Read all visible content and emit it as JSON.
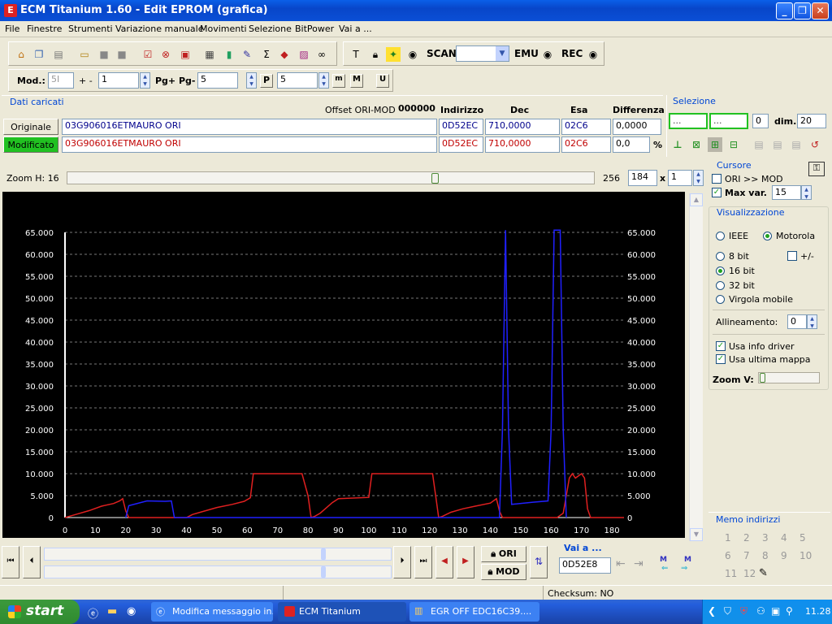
{
  "window": {
    "title": "ECM Titanium 1.60 - Edit EPROM (grafica)",
    "icon": "E",
    "min": "_",
    "max": "❐",
    "close": "✕"
  },
  "menu": [
    "File",
    "Finestre",
    "Strumenti",
    "Variazione manuale",
    "Movimenti",
    "Selezione",
    "BitPower",
    "Vai a ..."
  ],
  "toolbar1": {
    "scan_label": "SCAN",
    "emu_label": "EMU",
    "rec_label": "REC"
  },
  "toolbar2": {
    "mod_label": "Mod.:",
    "mod_value": "5I",
    "plusminus_label": "+ -",
    "plusminus_value": "1",
    "pg_label": "Pg+ Pg-",
    "pg_value": "5",
    "p_value": "5",
    "p_icon": "P",
    "m_icon": "m",
    "M_icon": "M",
    "U_icon": "U"
  },
  "dati": {
    "title": "Dati caricati",
    "offset_label": "Offset ORI-MOD",
    "offset_value": "000000",
    "col_indirizzo": "Indirizzo",
    "col_dec": "Dec",
    "col_esa": "Esa",
    "col_diff": "Differenza",
    "ori_button": "Originale",
    "mod_button": "Modificato",
    "ori": {
      "name": "03G906016ETMAURO ORI",
      "addr": "0D52EC",
      "dec": "710,0000",
      "esa": "02C6",
      "diff": "0,0000"
    },
    "mod": {
      "name": "03G906016ETMAURO ORI",
      "addr": "0D52EC",
      "dec": "710,0000",
      "esa": "02C6",
      "diff": "0,0",
      "pct": "%"
    }
  },
  "selezione": {
    "title": "Selezione",
    "from": "...",
    "to": "...",
    "count": "0",
    "dim_label": "dim.",
    "dim_value": "20"
  },
  "zoom": {
    "label": "Zoom H: 16",
    "right_value": "256",
    "val1": "184",
    "times": "x",
    "val2": "1"
  },
  "cursore": {
    "title": "Cursore",
    "ori_mod_label": "ORI >> MOD",
    "maxvar_label": "Max var.",
    "maxvar_value": "15"
  },
  "visualizzazione": {
    "title": "Visualizzazione",
    "ieee": "IEEE",
    "motorola": "Motorola",
    "bit8": "8 bit",
    "plusminus": "+/-",
    "bit16": "16 bit",
    "bit32": "32 bit",
    "float": "Virgola mobile",
    "allineamento_label": "Allineamento:",
    "allineamento_value": "0",
    "usa_info": "Usa info driver",
    "usa_ultima": "Usa ultima mappa",
    "zoomv_label": "Zoom V:"
  },
  "memo": {
    "title": "Memo indirizzi",
    "numbers": [
      "1",
      "2",
      "3",
      "4",
      "5",
      "6",
      "7",
      "8",
      "9",
      "10",
      "11",
      "12"
    ]
  },
  "nav": {
    "ori_label": "ORI",
    "mod_label": "MOD",
    "vai_label": "Vai a ...",
    "vai_value": "0D52E8",
    "m_left": "M",
    "m_right": "M"
  },
  "status": {
    "checksum": "Checksum: NO"
  },
  "taskbar": {
    "start": "start",
    "tasks": [
      "Modifica messaggio in...",
      "ECM Titanium",
      "EGR OFF EDC16C39...."
    ],
    "clock": "11.28"
  },
  "chart_data": {
    "type": "line",
    "xlabel": "",
    "ylabel": "",
    "xlim": [
      0,
      184
    ],
    "ylim": [
      0,
      65000
    ],
    "x_ticks": [
      0,
      10,
      20,
      30,
      40,
      50,
      60,
      70,
      80,
      90,
      100,
      110,
      120,
      130,
      140,
      150,
      160,
      170,
      180
    ],
    "y_ticks": [
      0,
      5000,
      10000,
      15000,
      20000,
      25000,
      30000,
      35000,
      40000,
      45000,
      50000,
      55000,
      60000,
      65000
    ],
    "y_tick_labels": [
      "0",
      "5.000",
      "10.000",
      "15.000",
      "20.000",
      "25.000",
      "30.000",
      "35.000",
      "40.000",
      "45.000",
      "50.000",
      "55.000",
      "60.000",
      "65.000"
    ],
    "grid": true,
    "series": [
      {
        "name": "",
        "color": "#E02020",
        "points": [
          [
            0,
            0
          ],
          [
            4,
            800
          ],
          [
            8,
            1600
          ],
          [
            12,
            2600
          ],
          [
            16,
            3200
          ],
          [
            18,
            3800
          ],
          [
            19,
            4300
          ],
          [
            20,
            1500
          ],
          [
            21,
            0
          ],
          [
            38,
            0
          ],
          [
            40,
            0
          ],
          [
            42,
            700
          ],
          [
            46,
            1500
          ],
          [
            50,
            2300
          ],
          [
            55,
            3000
          ],
          [
            59,
            3700
          ],
          [
            61,
            4500
          ],
          [
            62,
            10000
          ],
          [
            78,
            10000
          ],
          [
            80,
            5000
          ],
          [
            81,
            0
          ],
          [
            82,
            200
          ],
          [
            84,
            1000
          ],
          [
            86,
            2200
          ],
          [
            88,
            3400
          ],
          [
            90,
            4300
          ],
          [
            100,
            4600
          ],
          [
            101,
            10000
          ],
          [
            121,
            10000
          ],
          [
            122,
            5000
          ],
          [
            123,
            0
          ],
          [
            124,
            200
          ],
          [
            127,
            1200
          ],
          [
            131,
            2000
          ],
          [
            135,
            2600
          ],
          [
            140,
            3300
          ],
          [
            142,
            4300
          ],
          [
            143,
            1500
          ],
          [
            144,
            0
          ],
          [
            162,
            0
          ],
          [
            164,
            1000
          ],
          [
            166,
            9000
          ],
          [
            167,
            10000
          ],
          [
            168,
            9000
          ],
          [
            170,
            10000
          ],
          [
            171,
            9000
          ],
          [
            172,
            2000
          ],
          [
            173,
            0
          ],
          [
            184,
            0
          ]
        ]
      },
      {
        "name": "",
        "color": "#2020FF",
        "points": [
          [
            20,
            0
          ],
          [
            21,
            2700
          ],
          [
            27,
            3800
          ],
          [
            33,
            3700
          ],
          [
            35,
            3800
          ],
          [
            36,
            0
          ],
          [
            143,
            0
          ],
          [
            144,
            20000
          ],
          [
            145,
            65500
          ],
          [
            146,
            20000
          ],
          [
            147,
            3000
          ],
          [
            154,
            3500
          ],
          [
            159,
            3800
          ],
          [
            160,
            20000
          ],
          [
            161,
            65500
          ],
          [
            163,
            65500
          ],
          [
            164,
            20000
          ],
          [
            165,
            0
          ]
        ]
      }
    ]
  }
}
